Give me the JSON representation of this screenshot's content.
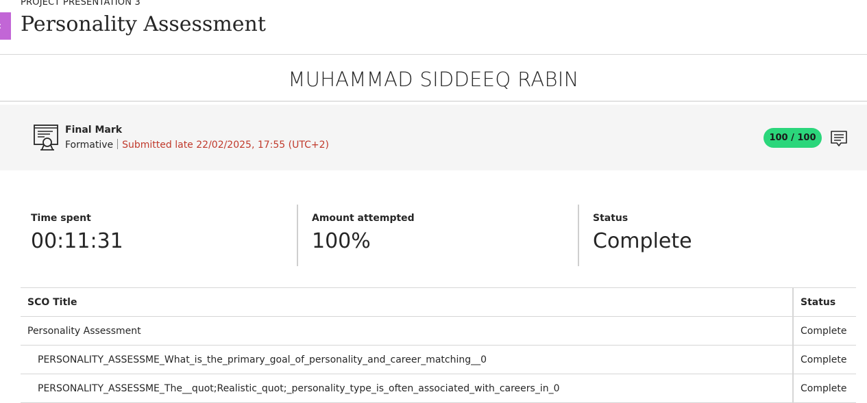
{
  "header": {
    "breadcrumb": "PROJECT PRESENTATION 3",
    "title": "Personality Assessment",
    "back_icon": "chevron-left-icon",
    "accent_color": "#c266d6"
  },
  "student": {
    "name": "MUHAMMAD SIDDEEQ RABIN"
  },
  "grade": {
    "icon": "certificate-icon",
    "title": "Final Mark",
    "type": "Formative",
    "submission": "Submitted late 22/02/2025, 17:55 (UTC+2)",
    "submission_color": "#c0392b",
    "score": "100 / 100",
    "score_color": "#2bd67b",
    "feedback_icon": "feedback-icon"
  },
  "stats": [
    {
      "label": "Time spent",
      "value": "00:11:31"
    },
    {
      "label": "Amount attempted",
      "value": "100%"
    },
    {
      "label": "Status",
      "value": "Complete"
    }
  ],
  "table": {
    "headers": [
      "SCO Title",
      "Status"
    ],
    "rows": [
      {
        "title": "Personality Assessment",
        "status": "Complete"
      },
      {
        "title": "PERSONALITY_ASSESSME_What_is_the_primary_goal_of_personality_and_career_matching__0",
        "status": "Complete"
      },
      {
        "title": "PERSONALITY_ASSESSME_The__quot;Realistic_quot;_personality_type_is_often_associated_with_careers_in_0",
        "status": "Complete"
      }
    ]
  }
}
